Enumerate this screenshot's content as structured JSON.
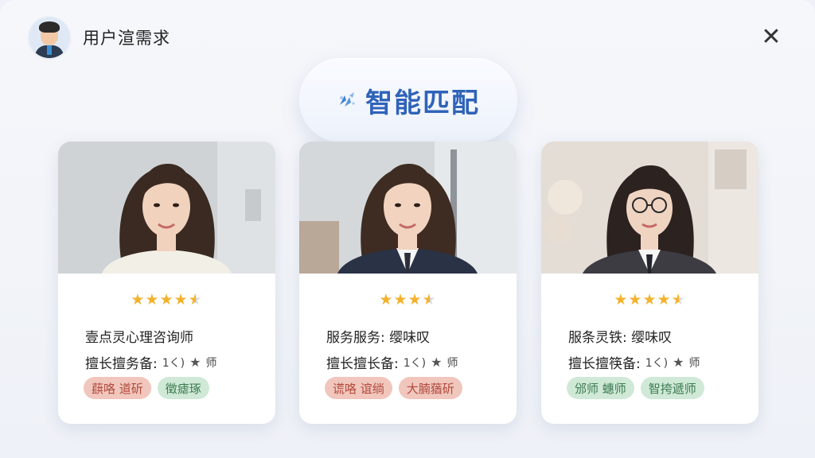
{
  "header": {
    "title": "用户渲需求",
    "close_symbol": "✕"
  },
  "match_pill": {
    "label": "智能匹配",
    "icon": "sparkle-icon"
  },
  "cards": [
    {
      "rating": 4.5,
      "title": "壹点灵心理咨询师",
      "expertise_label": "擅长擅务备:",
      "expertise_value": "1く)",
      "expertise_suffix": "师",
      "tags": [
        {
          "text": "蕻咯 道斫",
          "color": "red"
        },
        {
          "text": "徵瘧琢",
          "color": "green"
        }
      ]
    },
    {
      "rating": 4.5,
      "title": "服务服务: 缨味叹",
      "expertise_label": "擅长擅长备:",
      "expertise_value": "1く)",
      "expertise_suffix": "师",
      "tags": [
        {
          "text": "谎咯 谊绱",
          "color": "red"
        },
        {
          "text": "大腩蕕斫",
          "color": "red"
        }
      ]
    },
    {
      "rating": 4.5,
      "title": "服条灵铁: 缨味叹",
      "expertise_label": "擅长擅筷备:",
      "expertise_value": "1く)",
      "expertise_suffix": "师",
      "tags": [
        {
          "text": "邠师 蟪师",
          "color": "green"
        },
        {
          "text": "智挎遞师",
          "color": "green"
        }
      ]
    }
  ],
  "colors": {
    "accent_blue": "#2f63b8",
    "star_gold": "#f3b22c",
    "tag_red_bg": "#f1c6bd",
    "tag_green_bg": "#cfe9d6"
  }
}
